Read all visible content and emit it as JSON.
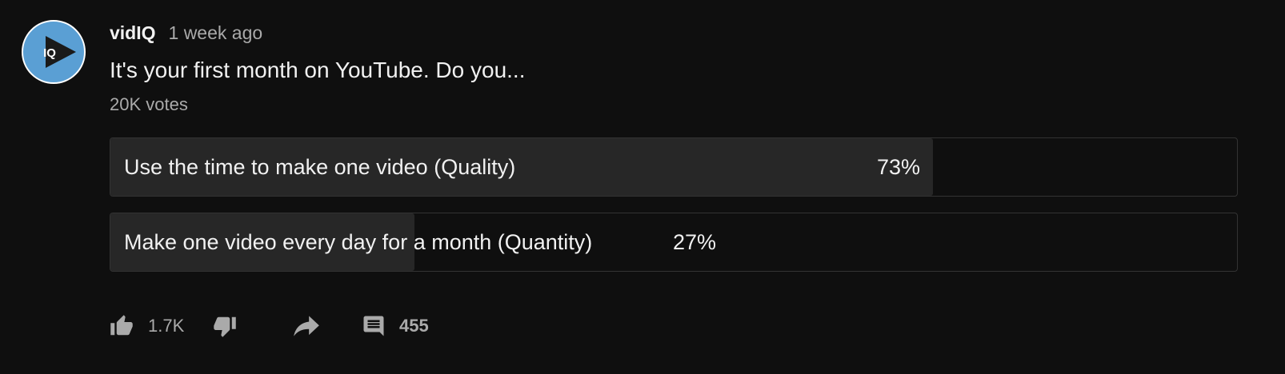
{
  "post": {
    "author": "vidIQ",
    "time": "1 week ago",
    "avatar_label": "IQ",
    "question": "It's your first month on YouTube. Do you...",
    "votes": "20K votes"
  },
  "poll": {
    "options": [
      {
        "label": "Use the time to make one video (Quality)",
        "percent_label": "73%",
        "percent": 73
      },
      {
        "label": "Make one video every day for a month (Quantity)",
        "percent_label": "27%",
        "percent": 27
      }
    ]
  },
  "actions": {
    "like_icon": "thumb-up-icon",
    "like_count": "1.7K",
    "dislike_icon": "thumb-down-icon",
    "share_icon": "share-icon",
    "comment_icon": "comment-icon",
    "comment_count": "455"
  },
  "colors": {
    "background": "#0f0f0f",
    "avatar_bg": "#5a9fd4",
    "poll_fill": "#272727",
    "poll_border": "#333333",
    "secondary_text": "#aaaaaa",
    "primary_text": "#f1f1f1"
  }
}
